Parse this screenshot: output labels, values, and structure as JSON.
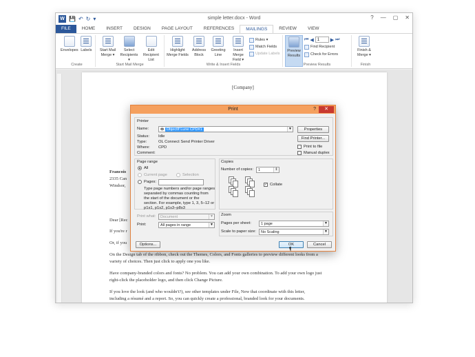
{
  "window": {
    "title": "simple letter.docx - Word",
    "controls": {
      "help": "?",
      "minimize": "—",
      "restore": "▢",
      "close": "✕"
    }
  },
  "qat": {
    "logo": "W",
    "save": "💾",
    "undo": "↶",
    "redo": "↻",
    "more": "▾"
  },
  "tabs": [
    "FILE",
    "HOME",
    "INSERT",
    "DESIGN",
    "PAGE LAYOUT",
    "REFERENCES",
    "MAILINGS",
    "REVIEW",
    "VIEW"
  ],
  "ribbon": {
    "create": {
      "label": "Create",
      "envelopes": "Envelopes",
      "labels": "Labels"
    },
    "start": {
      "label": "Start Mail Merge",
      "start_mail_merge": "Start Mail Merge ▾",
      "select_recipients": "Select Recipients ▾",
      "edit_recipient_list": "Edit Recipient List"
    },
    "write": {
      "label": "Write & Insert Fields",
      "highlight": "Highlight Merge Fields",
      "address_block": "Address Block",
      "greeting_line": "Greeting Line",
      "insert_merge_field": "Insert Merge Field ▾",
      "rules": "Rules ▾",
      "match_fields": "Match Fields",
      "update_labels": "Update Labels"
    },
    "preview": {
      "label": "Preview Results",
      "preview_results": "Preview Results",
      "record": "1",
      "find_recipient": "Find Recipient",
      "check_errors": "Check for Errors"
    },
    "finish": {
      "label": "Finish",
      "finish_merge": "Finish & Merge ▾"
    }
  },
  "document": {
    "company": "[Company]",
    "sender_name": "Francois",
    "sender_addr1": "2335 Can",
    "sender_addr2": "Windsor,",
    "dear": "Dear [Rec",
    "line_a": "If you're r",
    "line_b": "Or, if you",
    "para1a": "On the Design tab of the ribbon, check out the Themes, Colors, and Fonts galleries to preview different looks from a",
    "para1b": "variety of choices. Then just click to apply one you like.",
    "para2a": "Have company-branded colors and fonts? No problem. You can add your own combination. To add your own logo just",
    "para2b": "right-click the placeholder logo, and then click Change Picture.",
    "para3a": "If you love the look (and who wouldn't?), see other templates under File, New that coordinate with this letter,",
    "para3b": "including a résumé and a report. So, you can quickly create a professional, branded look for your documents."
  },
  "print_dialog": {
    "title": "Print",
    "help": "?",
    "close": "✕",
    "printer": {
      "section": "Printer",
      "name_label": "Name:",
      "name_value": "ObjectIf Lune CPD#1",
      "status_label": "Status:",
      "status_value": "Idle",
      "type_label": "Type:",
      "type_value": "OL Connect Send Printer Driver",
      "where_label": "Where:",
      "where_value": "CPD",
      "comment_label": "Comment:",
      "comment_value": "",
      "properties": "Properties",
      "find_printer": "Find Printer...",
      "print_to_file": "Print to file",
      "manual_duplex": "Manual duplex"
    },
    "page_range": {
      "section": "Page range",
      "all": "All",
      "current_page": "Current page",
      "selection": "Selection",
      "pages": "Pages:",
      "pages_value": "",
      "hint1": "Type page numbers and/or page ranges",
      "hint2": "separated by commas counting from",
      "hint3": "the start of the document or the",
      "hint4": "section. For example, type 1, 3, 5–12 or",
      "hint5": "p1s1, p1s2, p1s3–p8s3"
    },
    "copies": {
      "section": "Copies",
      "number_label": "Number of copies:",
      "number_value": "1",
      "collate": "Collate"
    },
    "print_what": {
      "label": "Print what:",
      "value": "Document"
    },
    "print": {
      "label": "Print:",
      "value": "All pages in range"
    },
    "zoom": {
      "section": "Zoom",
      "pages_per_sheet_label": "Pages per sheet:",
      "pages_per_sheet_value": "1 page",
      "scale_label": "Scale to paper size:",
      "scale_value": "No Scaling"
    },
    "options": "Options...",
    "ok": "OK",
    "cancel": "Cancel"
  }
}
